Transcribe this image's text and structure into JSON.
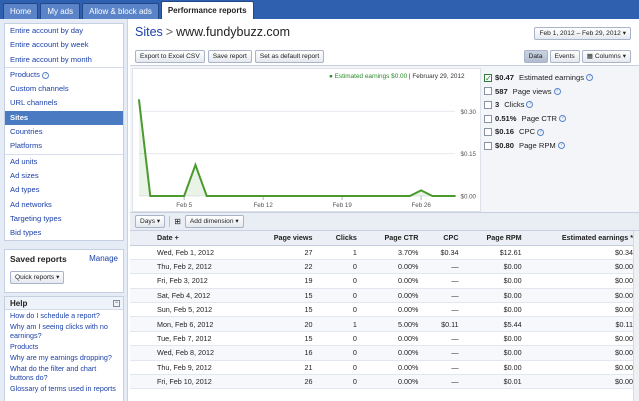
{
  "tabs": [
    "Home",
    "My ads",
    "Allow & block ads",
    "Performance reports"
  ],
  "sidebar": {
    "group1": [
      "Entire account by day",
      "Entire account by week",
      "Entire account by month"
    ],
    "group2": [
      "Products",
      "Custom channels",
      "URL channels",
      "Sites",
      "Countries",
      "Platforms"
    ],
    "group3": [
      "Ad units",
      "Ad sizes",
      "Ad types",
      "Ad networks",
      "Targeting types",
      "Bid types"
    ],
    "saved_title": "Saved reports",
    "manage": "Manage",
    "quick_reports": "Quick reports",
    "help_title": "Help",
    "help_links": [
      "How do I schedule a report?",
      "Why am I seeing clicks with no earnings?",
      "Products",
      "Why are my earnings dropping?",
      "What do the filter and chart buttons do?",
      "Glossary of terms used in reports"
    ]
  },
  "header": {
    "crumb": "Sites",
    "sep": ">",
    "site": "www.fundybuzz.com",
    "date_range": "Feb 1, 2012 – Feb 29, 2012"
  },
  "actions": [
    "Export to Excel CSV",
    "Save report",
    "Set as default report"
  ],
  "view": {
    "data": "Data",
    "events": "Events",
    "columns": "Columns"
  },
  "chart_legend": {
    "series": "Estimated earnings $0.00",
    "date": "February 29, 2012"
  },
  "chart_data": {
    "type": "line",
    "x_ticks": [
      "Feb 5",
      "Feb 12",
      "Feb 19",
      "Feb 26"
    ],
    "y_ticks": [
      "$0.30",
      "$0.15",
      "$0.00"
    ],
    "ylim": [
      0,
      0.4
    ],
    "series": [
      {
        "name": "Estimated earnings",
        "values": [
          0.34,
          0,
          0,
          0,
          0,
          0.11,
          0,
          0,
          0,
          0,
          0,
          0,
          0,
          0,
          0,
          0,
          0,
          0,
          0,
          0,
          0,
          0,
          0,
          0,
          0,
          0.02,
          0,
          0,
          0
        ]
      }
    ],
    "color": "#4a9a2e"
  },
  "metrics": [
    {
      "value": "$0.47",
      "label": "Estimated earnings",
      "checked": true,
      "help": true
    },
    {
      "value": "587",
      "label": "Page views",
      "checked": false,
      "help": true
    },
    {
      "value": "3",
      "label": "Clicks",
      "checked": false,
      "help": true
    },
    {
      "value": "0.51%",
      "label": "Page CTR",
      "checked": false,
      "help": true
    },
    {
      "value": "$0.16",
      "label": "CPC",
      "checked": false,
      "help": true
    },
    {
      "value": "$0.80",
      "label": "Page RPM",
      "checked": false,
      "help": true
    }
  ],
  "dim": {
    "days": "Days",
    "add_dimension": "Add dimension"
  },
  "table": {
    "headers": [
      "Date +",
      "Page views",
      "Clicks",
      "Page CTR",
      "CPC",
      "Page RPM",
      "Estimated earnings *"
    ],
    "rows": [
      [
        "Wed, Feb 1, 2012",
        "27",
        "1",
        "3.70%",
        "$0.34",
        "$12.61",
        "$0.34"
      ],
      [
        "Thu, Feb 2, 2012",
        "22",
        "0",
        "0.00%",
        "—",
        "$0.00",
        "$0.00"
      ],
      [
        "Fri, Feb 3, 2012",
        "19",
        "0",
        "0.00%",
        "—",
        "$0.00",
        "$0.00"
      ],
      [
        "Sat, Feb 4, 2012",
        "15",
        "0",
        "0.00%",
        "—",
        "$0.00",
        "$0.00"
      ],
      [
        "Sun, Feb 5, 2012",
        "15",
        "0",
        "0.00%",
        "—",
        "$0.00",
        "$0.00"
      ],
      [
        "Mon, Feb 6, 2012",
        "20",
        "1",
        "5.00%",
        "$0.11",
        "$5.44",
        "$0.11"
      ],
      [
        "Tue, Feb 7, 2012",
        "15",
        "0",
        "0.00%",
        "—",
        "$0.00",
        "$0.00"
      ],
      [
        "Wed, Feb 8, 2012",
        "16",
        "0",
        "0.00%",
        "—",
        "$0.00",
        "$0.00"
      ],
      [
        "Thu, Feb 9, 2012",
        "21",
        "0",
        "0.00%",
        "—",
        "$0.00",
        "$0.00"
      ],
      [
        "Fri, Feb 10, 2012",
        "26",
        "0",
        "0.00%",
        "—",
        "$0.01",
        "$0.00"
      ]
    ]
  }
}
